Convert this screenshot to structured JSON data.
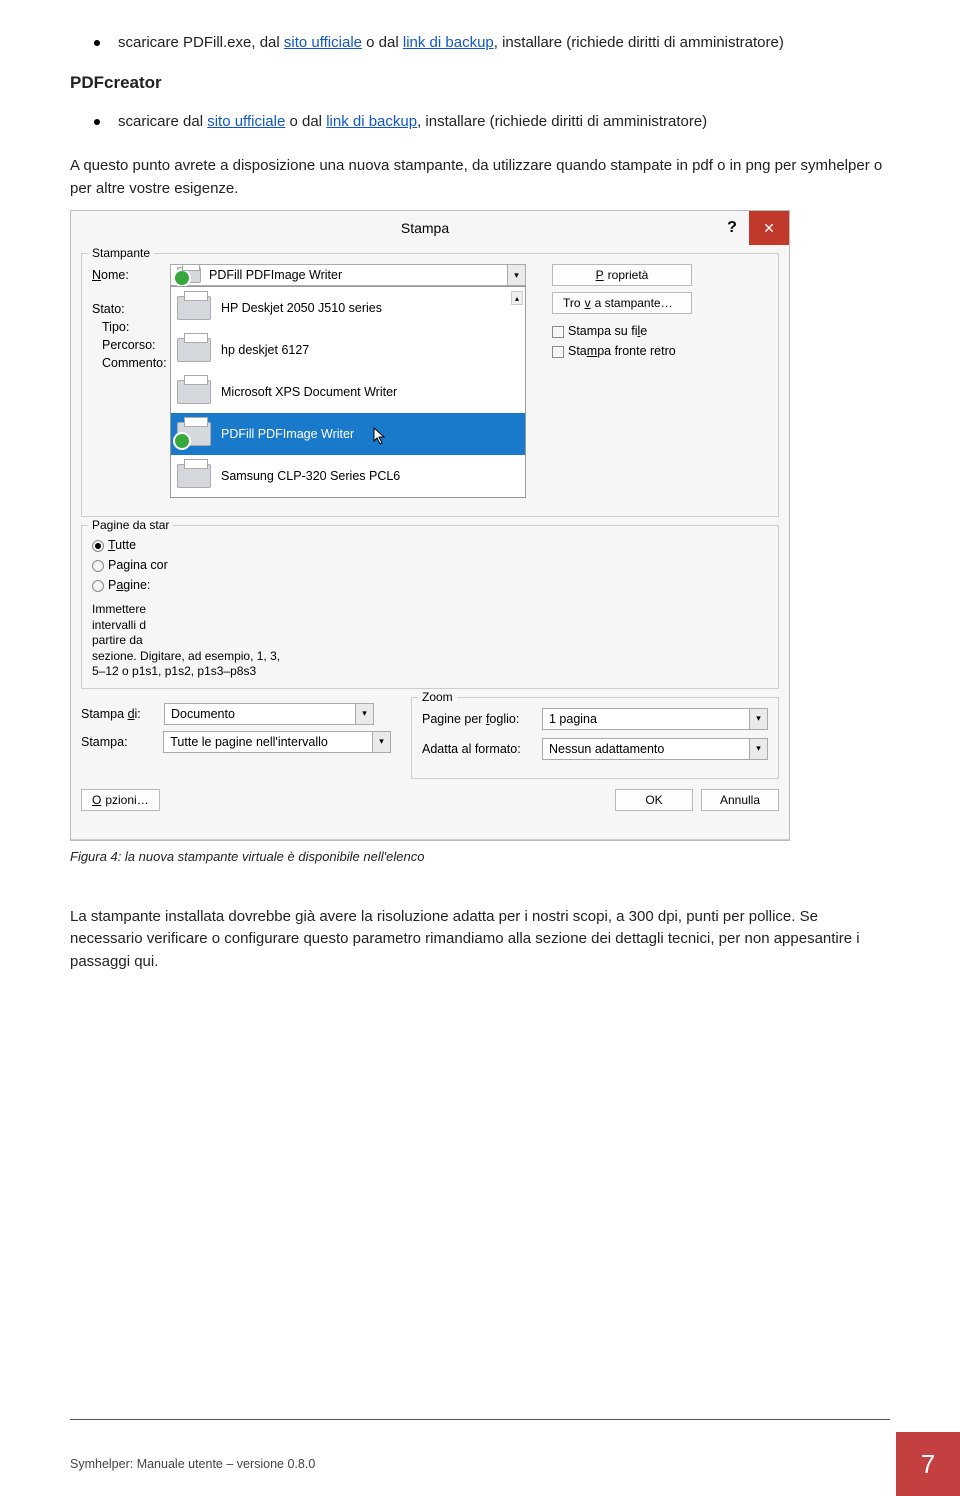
{
  "bullet1": {
    "pre": "scaricare PDFill.exe, dal ",
    "link1": "sito ufficiale",
    "mid1": " o dal ",
    "link2": "link di backup",
    "post": ", installare (richiede diritti di amministratore)"
  },
  "section_h": "PDFcreator",
  "bullet2": {
    "pre": "scaricare dal ",
    "link1": "sito ufficiale",
    "mid1": " o dal ",
    "link2": "link di backup",
    "post": ", installare (richiede diritti di amministratore)"
  },
  "para1": "A questo punto avrete a disposizione una nuova stampante, da utilizzare quando stampate in pdf o in png per symhelper o per altre vostre esigenze.",
  "dialog": {
    "title": "Stampa",
    "help": "?",
    "close": "✕",
    "stampante_label": "Stampante",
    "nome": "Nome:",
    "nome_value": "PDFill PDFImage Writer",
    "stato": "Stato:",
    "tipo": "Tipo:",
    "percorso": "Percorso:",
    "commento": "Commento:",
    "proprieta": "Proprietà",
    "trova": "Trova stampante…",
    "stampa_file": "Stampa su file",
    "fronte_retro": "Stampa fronte retro",
    "printers": [
      {
        "name": "HP Deskjet 2050 J510 series",
        "selected": false
      },
      {
        "name": "hp deskjet 6127",
        "selected": false
      },
      {
        "name": "Microsoft XPS Document Writer",
        "selected": false
      },
      {
        "name": "PDFill PDFImage Writer",
        "selected": true
      },
      {
        "name": "Samsung CLP-320 Series PCL6",
        "selected": false
      }
    ],
    "pagine_label": "Pagine da star",
    "r_tutte": "Tutte",
    "r_pagina_cor": "Pagina cor",
    "r_pagine": "Pagine:",
    "pagine_note": "Immettere\nintervalli d\npartire da\nsezione. Digitare, ad esempio, 1, 3,\n5–12 o p1s1, p1s2, p1s3–p8s3",
    "stampa_di": "Stampa di:",
    "stampa_di_val": "Documento",
    "stampa": "Stampa:",
    "stampa_val": "Tutte le pagine nell'intervallo",
    "zoom_label": "Zoom",
    "pagine_per_foglio": "Pagine per foglio:",
    "pagine_per_foglio_val": "1 pagina",
    "adatta": "Adatta al formato:",
    "adatta_val": "Nessun adattamento",
    "opzioni": "Opzioni…",
    "ok": "OK",
    "annulla": "Annulla"
  },
  "caption": "Figura  4: la nuova stampante virtuale è disponibile  nell'elenco",
  "para2": "La stampante installata dovrebbe già avere la risoluzione adatta per i nostri scopi, a 300 dpi, punti per pollice. Se necessario verificare o configurare questo parametro rimandiamo alla sezione dei dettagli tecnici, per non appesantire i passaggi qui.",
  "footer_text": "Symhelper: Manuale utente – versione 0.8.0",
  "page_no": "7"
}
